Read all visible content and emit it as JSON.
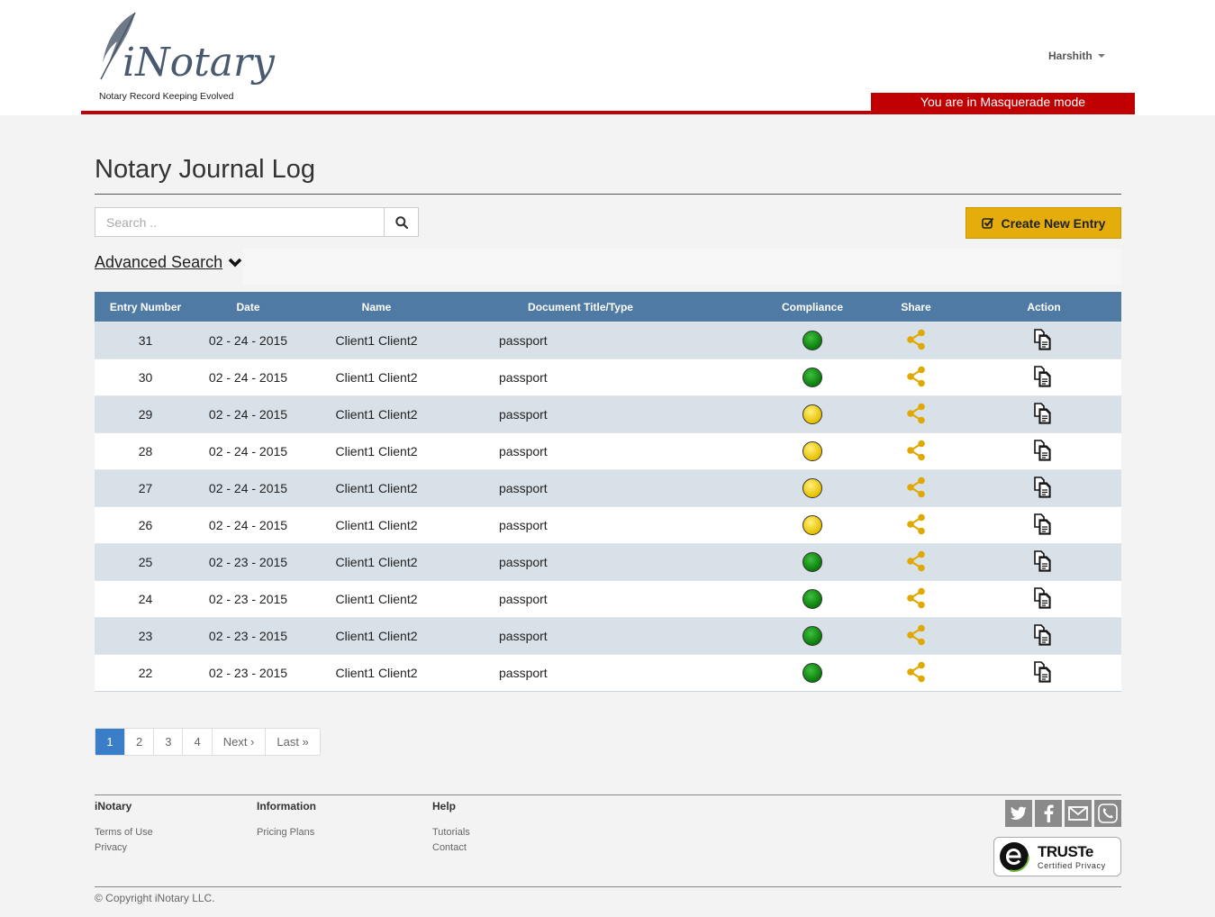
{
  "header": {
    "logo_word": "iNotary",
    "logo_tagline": "Notary Record Keeping Evolved",
    "user_name": "Harshith",
    "masquerade_notice": "You are in Masquerade mode"
  },
  "page": {
    "title": "Notary Journal Log"
  },
  "search": {
    "placeholder": "Search ..",
    "advanced_label": "Advanced Search"
  },
  "toolbar": {
    "create_label": "Create New Entry"
  },
  "table": {
    "columns": [
      "Entry Number",
      "Date",
      "Name",
      "Document Title/Type",
      "Compliance",
      "Share",
      "Action"
    ],
    "rows": [
      {
        "entry": "31",
        "date": "02 - 24 - 2015",
        "name": "Client1 Client2",
        "doc": "passport",
        "compliance": "green"
      },
      {
        "entry": "30",
        "date": "02 - 24 - 2015",
        "name": "Client1 Client2",
        "doc": "passport",
        "compliance": "green"
      },
      {
        "entry": "29",
        "date": "02 - 24 - 2015",
        "name": "Client1 Client2",
        "doc": "passport",
        "compliance": "yellow"
      },
      {
        "entry": "28",
        "date": "02 - 24 - 2015",
        "name": "Client1 Client2",
        "doc": "passport",
        "compliance": "yellow"
      },
      {
        "entry": "27",
        "date": "02 - 24 - 2015",
        "name": "Client1 Client2",
        "doc": "passport",
        "compliance": "yellow"
      },
      {
        "entry": "26",
        "date": "02 - 24 - 2015",
        "name": "Client1 Client2",
        "doc": "passport",
        "compliance": "yellow"
      },
      {
        "entry": "25",
        "date": "02 - 23 - 2015",
        "name": "Client1 Client2",
        "doc": "passport",
        "compliance": "green"
      },
      {
        "entry": "24",
        "date": "02 - 23 - 2015",
        "name": "Client1 Client2",
        "doc": "passport",
        "compliance": "green"
      },
      {
        "entry": "23",
        "date": "02 - 23 - 2015",
        "name": "Client1 Client2",
        "doc": "passport",
        "compliance": "green"
      },
      {
        "entry": "22",
        "date": "02 - 23 - 2015",
        "name": "Client1 Client2",
        "doc": "passport",
        "compliance": "green"
      }
    ]
  },
  "pagination": {
    "pages": [
      "1",
      "2",
      "3",
      "4"
    ],
    "current": "1",
    "next_label": "Next ›",
    "last_label": "Last »"
  },
  "footer": {
    "col1": {
      "heading": "iNotary",
      "links": [
        "Terms of Use",
        "Privacy"
      ]
    },
    "col2": {
      "heading": "Information",
      "links": [
        "Pricing Plans"
      ]
    },
    "col3": {
      "heading": "Help",
      "links": [
        "Tutorials",
        "Contact"
      ]
    },
    "social_icons": [
      "twitter-icon",
      "facebook-icon",
      "mail-icon",
      "phone-icon"
    ],
    "truste_title": "TRUSTe",
    "truste_subtitle": "Certified Privacy",
    "copyright": "© Copyright iNotary LLC."
  },
  "colors": {
    "accent_red": "#c00000",
    "table_header": "#4f7aa3",
    "create_button": "#e4ad0c",
    "share_icon": "#e0a800",
    "compliance_green": "#0a9a0a",
    "compliance_yellow": "#f3d11a"
  }
}
